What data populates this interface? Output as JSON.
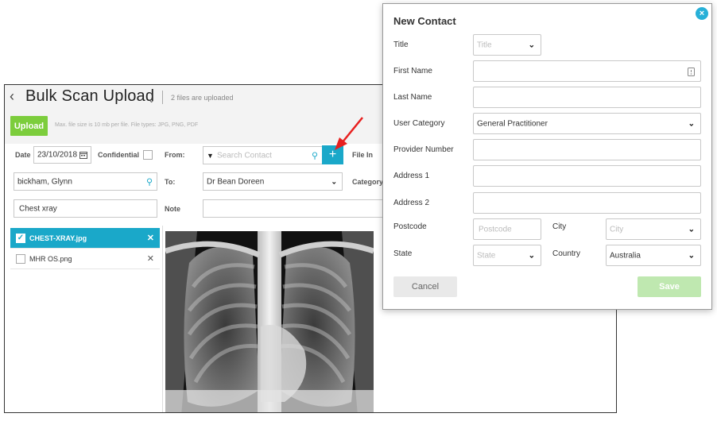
{
  "app": {
    "title": "Bulk Scan Upload",
    "files_status": "2 files are uploaded",
    "upload_label": "Upload",
    "upload_hint": "Max. file size is 10 mb per file. File types: JPG, PNG, PDF",
    "date_label": "Date",
    "date_value": "23/10/2018",
    "confidential_label": "Confidential",
    "from_label": "From:",
    "search_placeholder": "Search Contact",
    "plus_label": "+",
    "file_in_label": "File In",
    "patient_value": "bickham, Glynn",
    "to_label": "To:",
    "to_value": "Dr Bean Doreen",
    "category_label": "Category",
    "description_value": "Chest xray",
    "note_label": "Note",
    "files": [
      {
        "name": "CHEST-XRAY.jpg",
        "selected": true
      },
      {
        "name": "MHR OS.png",
        "selected": false
      }
    ]
  },
  "modal": {
    "title": "New Contact",
    "close_label": "×",
    "title_label": "Title",
    "title_placeholder": "Title",
    "first_name_label": "First Name",
    "last_name_label": "Last Name",
    "user_category_label": "User Category",
    "user_category_value": "General Practitioner",
    "provider_number_label": "Provider Number",
    "address1_label": "Address 1",
    "address2_label": "Address 2",
    "postcode_label": "Postcode",
    "postcode_placeholder": "Postcode",
    "city_label": "City",
    "city_placeholder": "City",
    "state_label": "State",
    "state_placeholder": "State",
    "country_label": "Country",
    "country_value": "Australia",
    "cancel_label": "Cancel",
    "save_label": "Save"
  },
  "colors": {
    "accent": "#1aa8c9",
    "upload_green": "#7ccd3c",
    "save_green_disabled": "#bfe8b0",
    "arrow_red": "#e8201f"
  },
  "icons": [
    "back-chevron-icon",
    "calendar-icon",
    "search-icon",
    "plus-icon",
    "close-icon",
    "check-icon",
    "chevron-down-icon",
    "id-card-icon"
  ]
}
